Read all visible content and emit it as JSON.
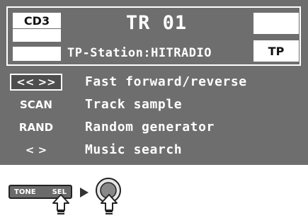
{
  "display": {
    "source_badge": "CD3",
    "track": "TR 01",
    "station": "TP-Station:HITRADIO",
    "tp_badge": "TP"
  },
  "functions": [
    {
      "key": "<< >>",
      "description": "Fast forward/reverse",
      "selected": true
    },
    {
      "key": "SCAN",
      "description": "Track sample",
      "selected": false
    },
    {
      "key": "RAND",
      "description": "Random generator",
      "selected": false
    },
    {
      "key": "< >",
      "description": "Music search",
      "selected": false
    }
  ],
  "controls": {
    "tone_label": "TONE",
    "sel_label": "SEL",
    "flow_arrow_icon": "play-arrow-icon",
    "press_icon": "press-arrow-icon",
    "knob_icon": "rotary-knob-icon"
  },
  "colors": {
    "screen_bg": "#6e6e6e",
    "text": "#ffffff"
  }
}
